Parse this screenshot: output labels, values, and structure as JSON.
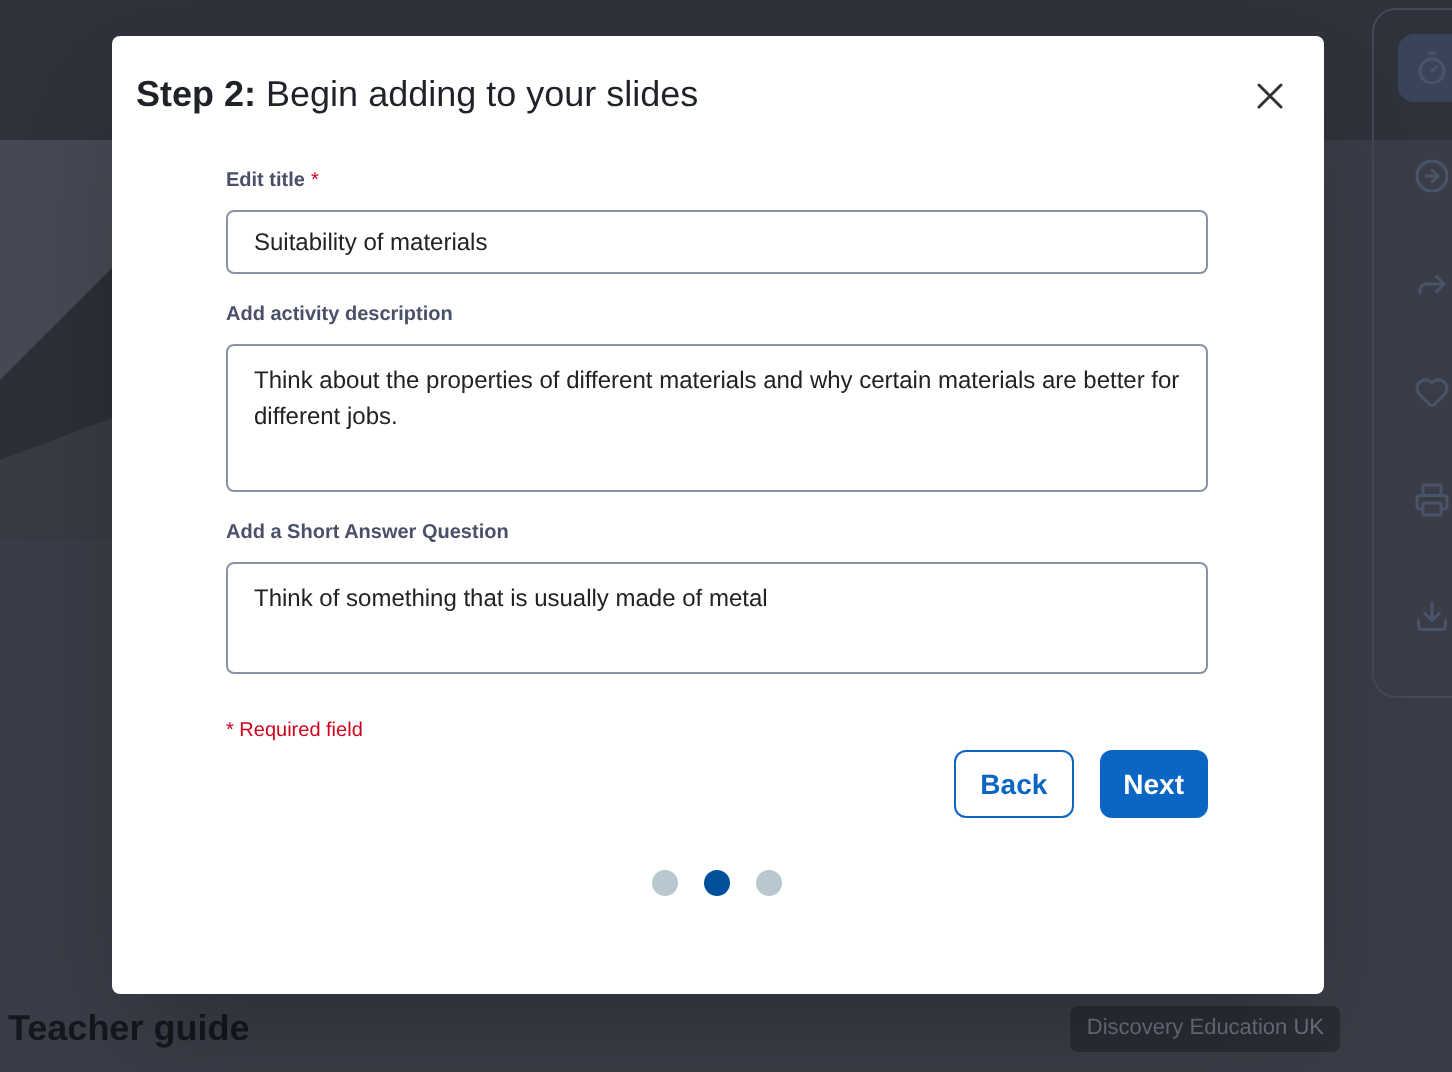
{
  "page": {
    "heading": "Teacher guide",
    "publisher_badge": "Discovery Education UK"
  },
  "dialog": {
    "title_step": "Step 2:",
    "title": "Begin adding to your slides",
    "fields": [
      {
        "label": "Edit title",
        "required_mark": "*",
        "kind": "line",
        "value": "Suitability of materials"
      },
      {
        "label": "Add activity description",
        "kind": "area",
        "value": "Think about the properties of different materials and why certain materials are better for different jobs."
      },
      {
        "label": "Add a Short Answer Question",
        "kind": "area",
        "value": "Think of something that is usually made of metal"
      }
    ],
    "required_note": "* Required field",
    "buttons": [
      {
        "label": "Back",
        "kind": "secondary"
      },
      {
        "label": "Next",
        "kind": "primary"
      }
    ],
    "steps": [
      {
        "selected": false
      },
      {
        "selected": true
      },
      {
        "selected": false
      }
    ]
  }
}
